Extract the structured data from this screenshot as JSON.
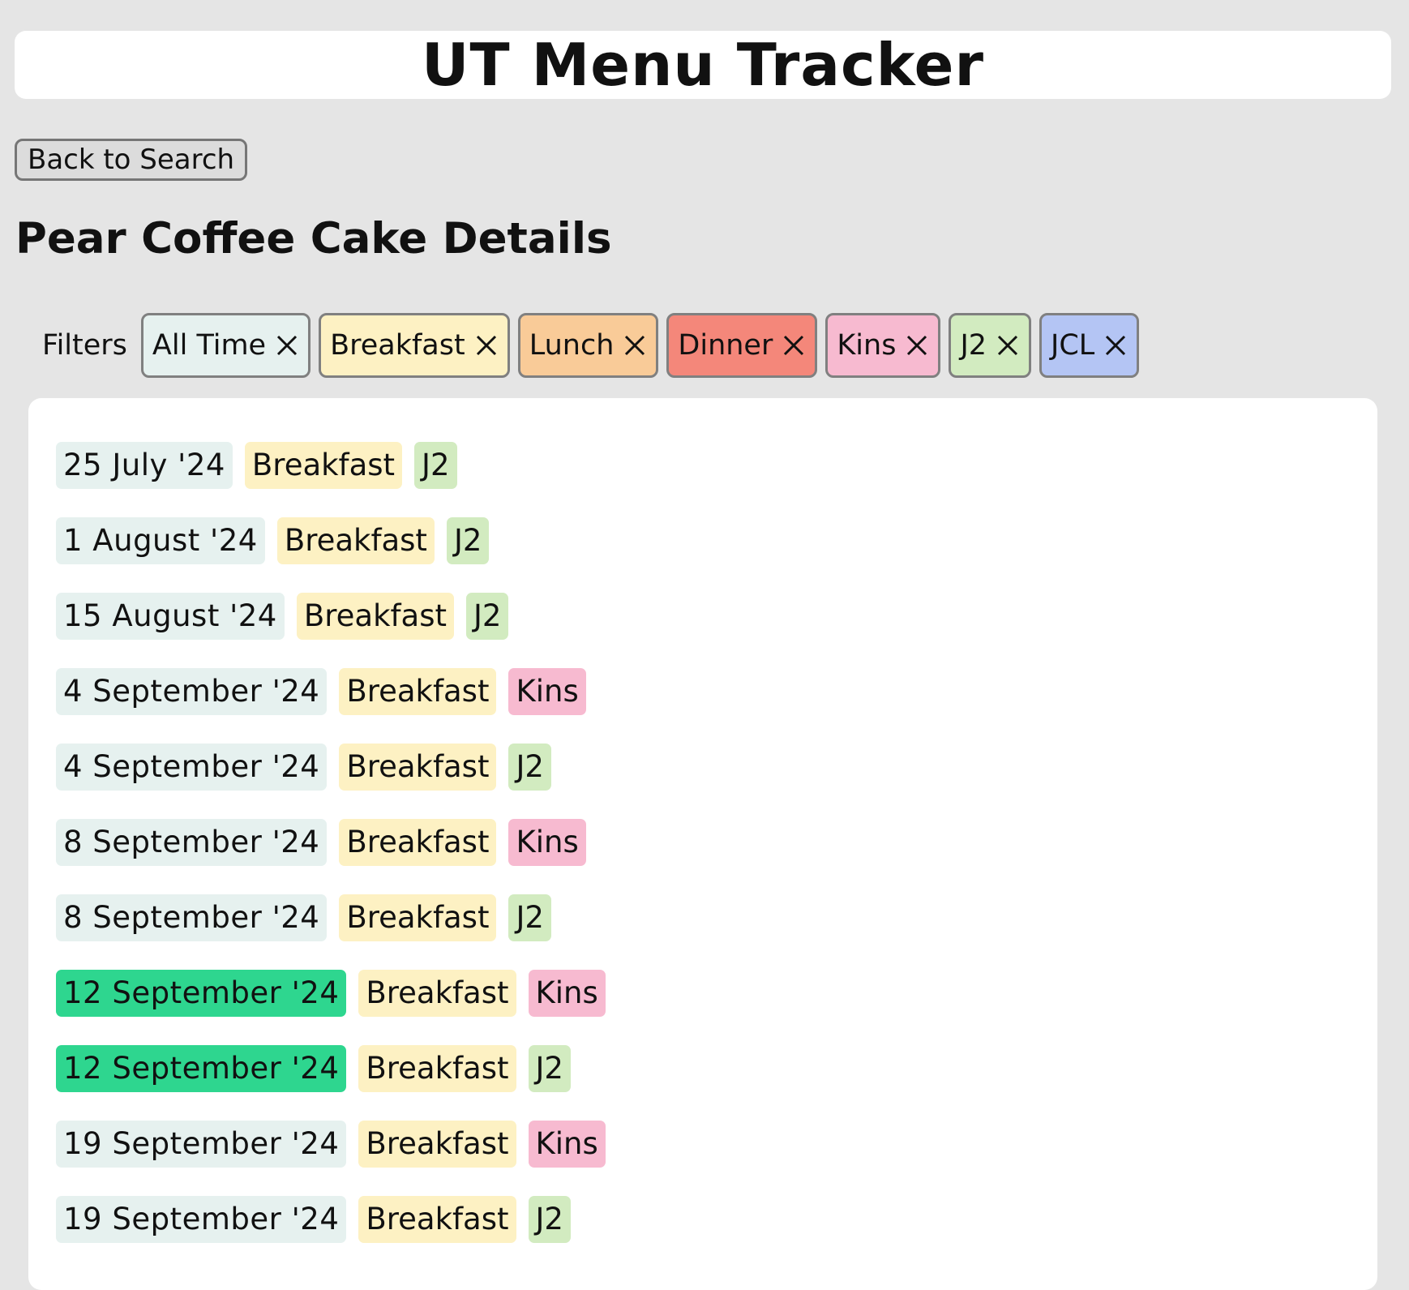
{
  "app": {
    "title": "UT Menu Tracker"
  },
  "nav": {
    "back_label": "Back to Search"
  },
  "page": {
    "title": "Pear Coffee Cake Details"
  },
  "filters": {
    "label": "Filters",
    "chips": [
      {
        "label": "All Time",
        "color": "#e6f1ef",
        "icon": "close-icon"
      },
      {
        "label": "Breakfast",
        "color": "#fdf1c3",
        "icon": "close-icon"
      },
      {
        "label": "Lunch",
        "color": "#f9cb98",
        "icon": "close-icon"
      },
      {
        "label": "Dinner",
        "color": "#f4877a",
        "icon": "close-icon"
      },
      {
        "label": "Kins",
        "color": "#f7bad0",
        "icon": "close-icon"
      },
      {
        "label": "J2",
        "color": "#d2ebc0",
        "icon": "close-icon"
      },
      {
        "label": "JCL",
        "color": "#b4c5f4",
        "icon": "close-icon"
      }
    ]
  },
  "colors": {
    "date_default": "#e6f1ef",
    "date_highlight": "#2ed68f",
    "meal_breakfast": "#fdf1c3",
    "location_kins": "#f7bad0",
    "location_j2": "#d2ebc0"
  },
  "entries": [
    {
      "date": "25 July '24",
      "meal": "Breakfast",
      "location": "J2",
      "highlight": false
    },
    {
      "date": "1 August '24",
      "meal": "Breakfast",
      "location": "J2",
      "highlight": false
    },
    {
      "date": "15 August '24",
      "meal": "Breakfast",
      "location": "J2",
      "highlight": false
    },
    {
      "date": "4 September '24",
      "meal": "Breakfast",
      "location": "Kins",
      "highlight": false
    },
    {
      "date": "4 September '24",
      "meal": "Breakfast",
      "location": "J2",
      "highlight": false
    },
    {
      "date": "8 September '24",
      "meal": "Breakfast",
      "location": "Kins",
      "highlight": false
    },
    {
      "date": "8 September '24",
      "meal": "Breakfast",
      "location": "J2",
      "highlight": false
    },
    {
      "date": "12 September '24",
      "meal": "Breakfast",
      "location": "Kins",
      "highlight": true
    },
    {
      "date": "12 September '24",
      "meal": "Breakfast",
      "location": "J2",
      "highlight": true
    },
    {
      "date": "19 September '24",
      "meal": "Breakfast",
      "location": "Kins",
      "highlight": false
    },
    {
      "date": "19 September '24",
      "meal": "Breakfast",
      "location": "J2",
      "highlight": false
    }
  ]
}
